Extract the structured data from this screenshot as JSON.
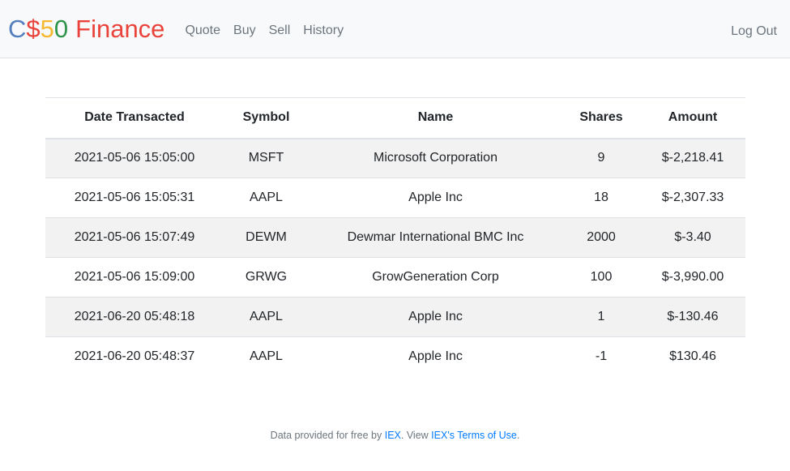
{
  "brand": {
    "p1": "C",
    "p2": "$",
    "p3": "5",
    "p4": "0",
    "p5": "Finance"
  },
  "nav": {
    "items": [
      "Quote",
      "Buy",
      "Sell",
      "History"
    ],
    "logout": "Log Out"
  },
  "table": {
    "headers": [
      "Date Transacted",
      "Symbol",
      "Name",
      "Shares",
      "Amount"
    ],
    "rows": [
      [
        "2021-05-06 15:05:00",
        "MSFT",
        "Microsoft Corporation",
        "9",
        "$-2,218.41"
      ],
      [
        "2021-05-06 15:05:31",
        "AAPL",
        "Apple Inc",
        "18",
        "$-2,307.33"
      ],
      [
        "2021-05-06 15:07:49",
        "DEWM",
        "Dewmar International BMC Inc",
        "2000",
        "$-3.40"
      ],
      [
        "2021-05-06 15:09:00",
        "GRWG",
        "GrowGeneration Corp",
        "100",
        "$-3,990.00"
      ],
      [
        "2021-06-20 05:48:18",
        "AAPL",
        "Apple Inc",
        "1",
        "$-130.46"
      ],
      [
        "2021-06-20 05:48:37",
        "AAPL",
        "Apple Inc",
        "-1",
        "$130.46"
      ]
    ]
  },
  "footer": {
    "prefix": "Data provided for free by ",
    "iex_link": "IEX",
    "middle": ". View ",
    "terms_link": "IEX's Terms of Use",
    "suffix": "."
  },
  "colors": {
    "brand_blue": "#537fbe",
    "brand_red": "#ea433b",
    "brand_yellow": "#f5b82e",
    "brand_green": "#2e944b",
    "link": "#007bff"
  }
}
